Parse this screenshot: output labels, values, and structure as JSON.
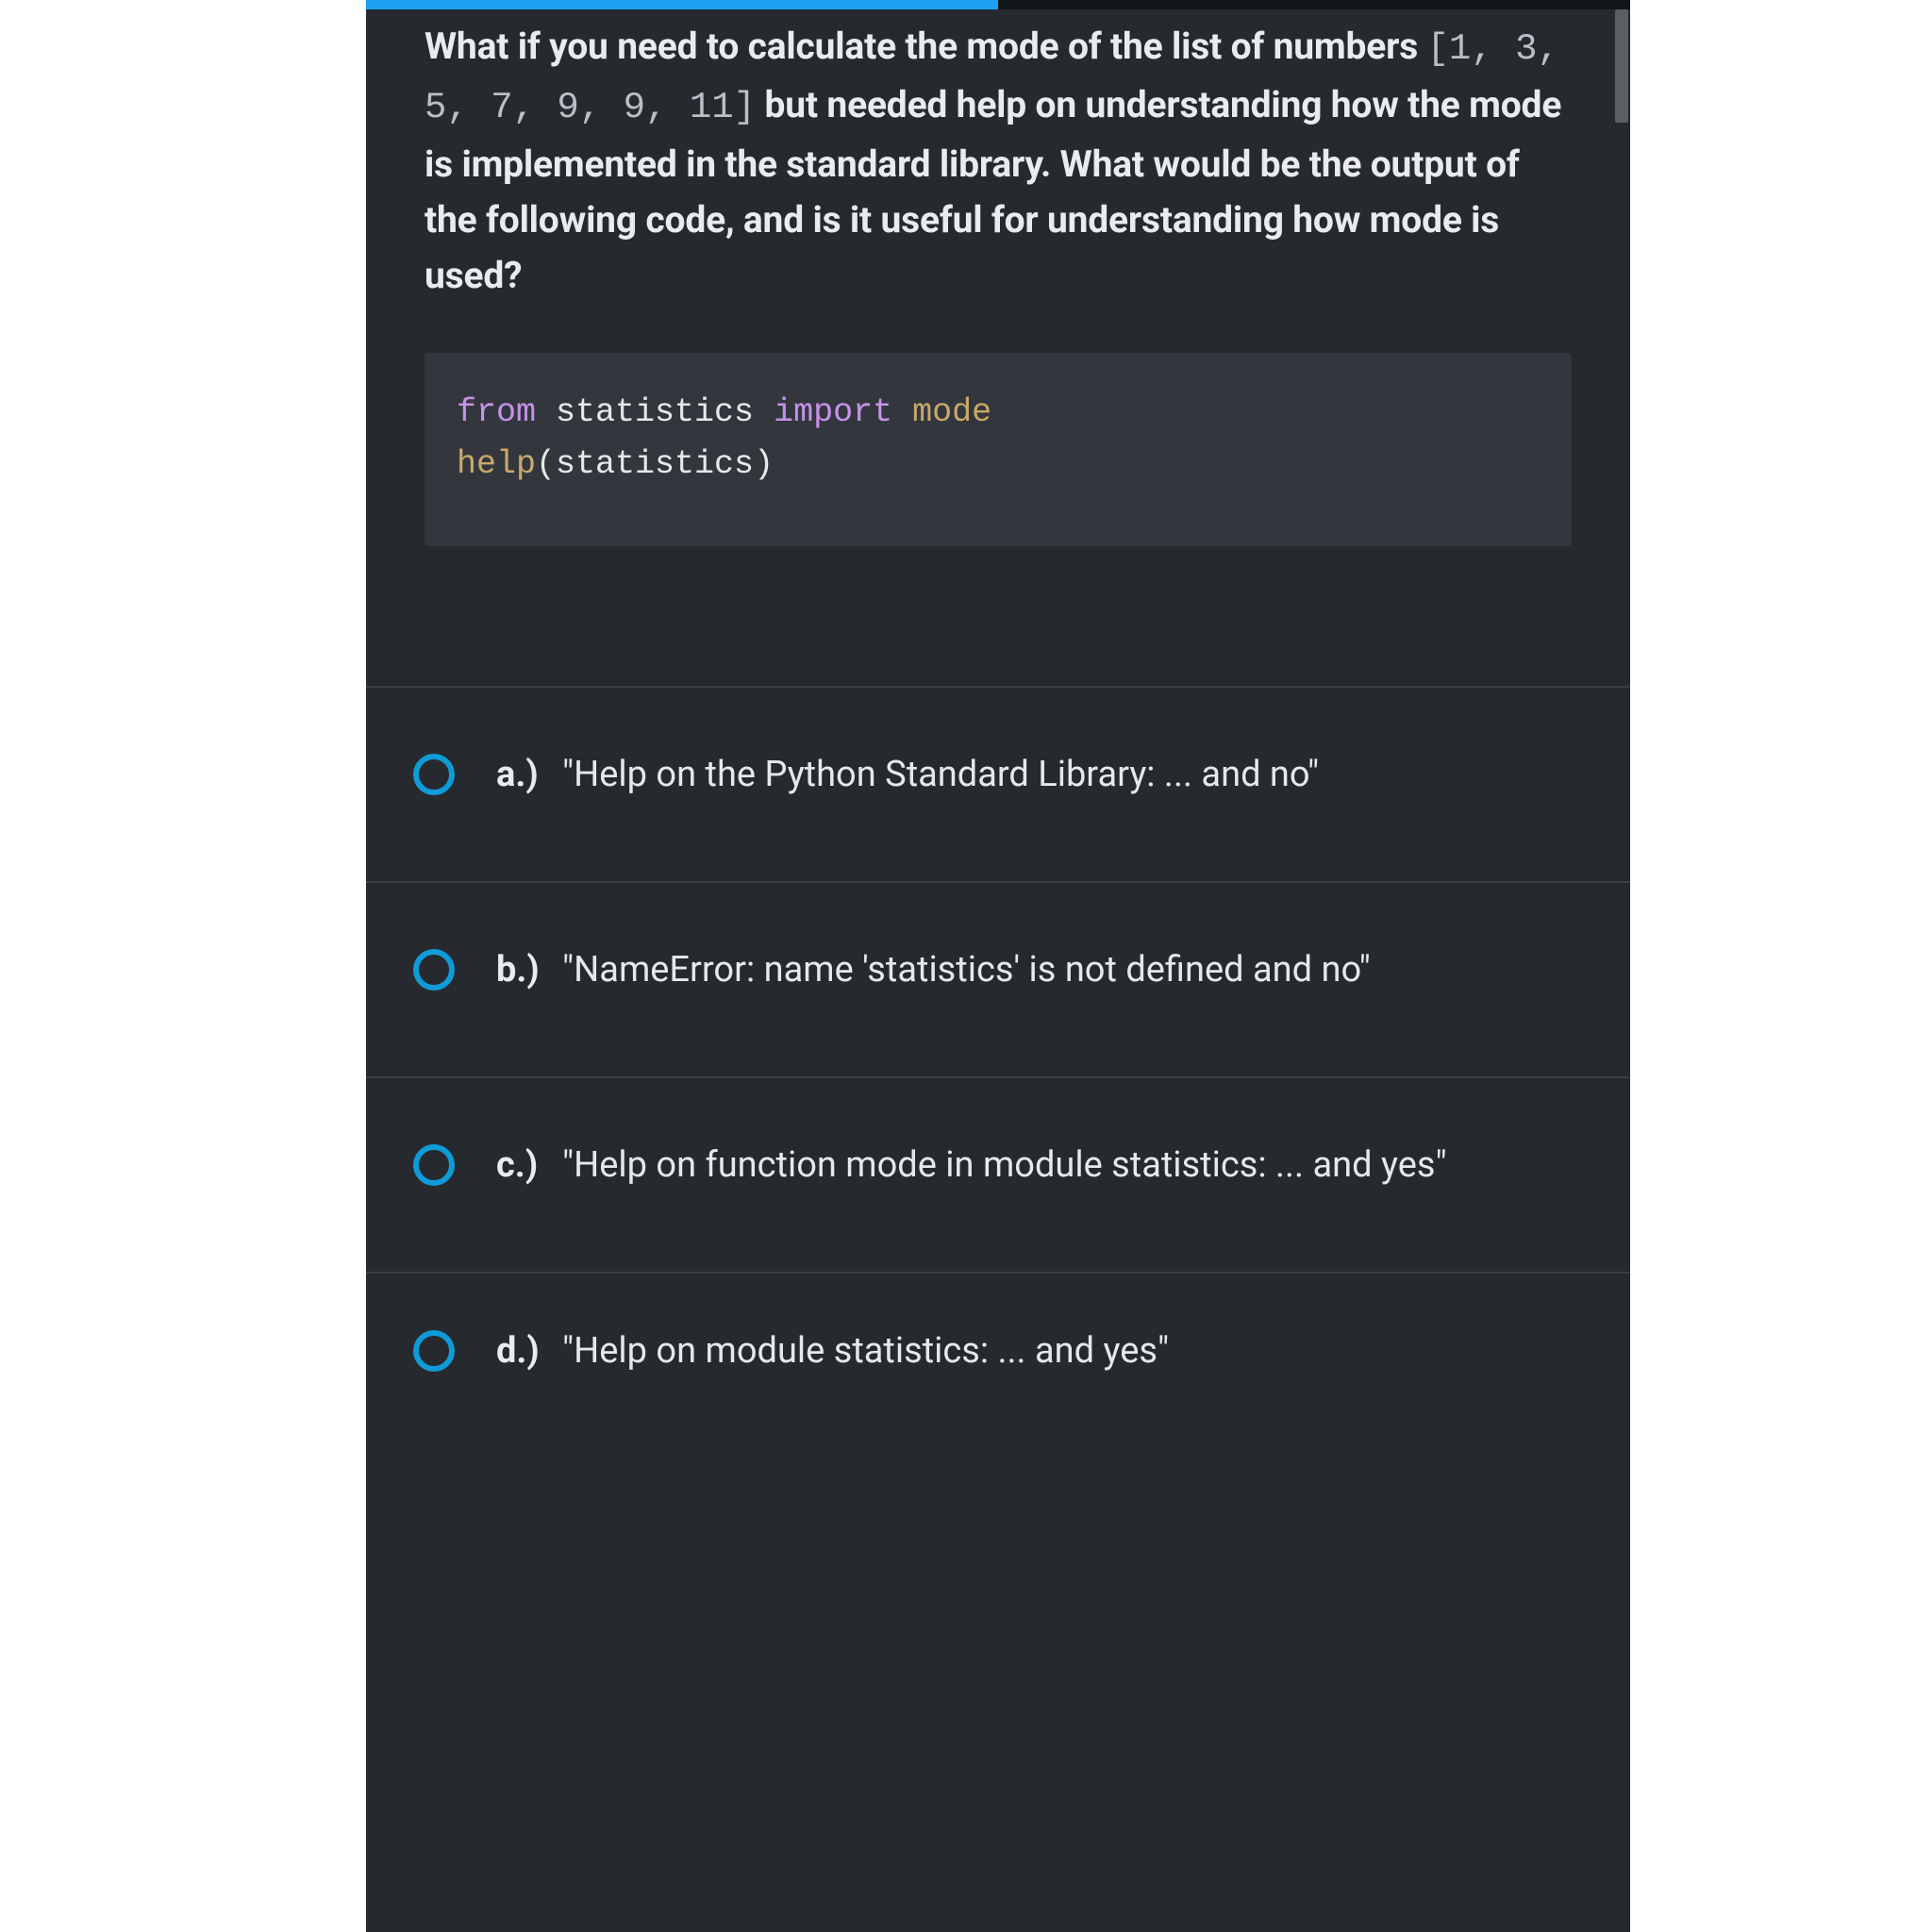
{
  "progress": {
    "percent": 50
  },
  "question": {
    "prefix": "What if you need to calculate the mode of the list of numbers ",
    "inline_list": "[1, 3, 5, 7, 9, 9, 11]",
    "suffix": " but needed help on understanding how the mode is implemented in the standard library. What would be the output of the following code, and is it useful for understanding how mode is used?"
  },
  "code": {
    "line1": {
      "kw1": "from",
      "ns": "statistics",
      "kw2": "import",
      "fn": "mode"
    },
    "line2": {
      "call": "help",
      "open": "(",
      "arg": "statistics",
      "close": ")"
    }
  },
  "answers": [
    {
      "label": "a.)",
      "text": "\"Help on the Python Standard Library: ... and no\""
    },
    {
      "label": "b.)",
      "text": "\"NameError: name 'statistics' is not defined and no\""
    },
    {
      "label": "c.)",
      "text": "\"Help on function mode in module statistics: ... and yes\""
    },
    {
      "label": "d.)",
      "text": "\"Help on module statistics: ... and yes\""
    }
  ]
}
